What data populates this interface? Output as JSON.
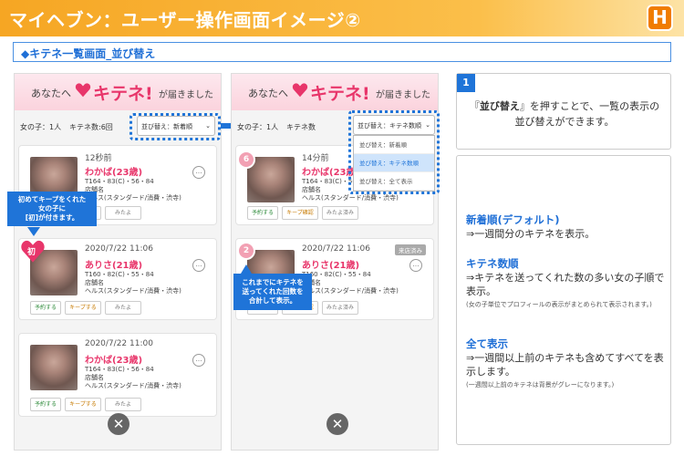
{
  "title": "マイヘブン：ユーザー操作画面イメージ②",
  "logo": "H",
  "section": "◆キテネ一覧画面_並び替え",
  "banner": {
    "prefix": "あなたへ",
    "kitene": "キテネ!",
    "suffix": "が届きました"
  },
  "left": {
    "count_girls": "女の子：1人",
    "count_kitene": "キテネ数:6回",
    "sort_label": "並び替え：新着順",
    "cards": [
      {
        "time": "12秒前",
        "name": "わかば(23歳)",
        "spec": "T164・83(C)・56・84",
        "store": "店舗名",
        "genre": "ヘルス(スタンダード/消費・渋寺)",
        "badge": ""
      },
      {
        "time": "2020/7/22 11:06",
        "name": "ありさ(21歳)",
        "spec": "T160・82(C)・55・84",
        "store": "店舗名",
        "genre": "ヘルス(スタンダード/消費・渋寺)",
        "badge": "初"
      },
      {
        "time": "2020/7/22 11:00",
        "name": "わかば(23歳)",
        "spec": "T164・83(C)・56・84",
        "store": "店舗名",
        "genre": "ヘルス(スタンダード/消費・渋寺)",
        "badge": ""
      }
    ],
    "callout": [
      "初めてキープをくれた",
      "女の子に",
      "[初]が付きます。"
    ]
  },
  "right": {
    "count_girls": "女の子：1人",
    "count_kitene": "キテネ数",
    "sort_label": "並び替え：キテネ数順",
    "dropdown": [
      "並び替え：新着順",
      "並び替え：キテネ数順",
      "並び替え：全て表示"
    ],
    "cards": [
      {
        "time": "14分前",
        "name": "わかば(23歳)",
        "spec": "T164・83(C)・56・84",
        "store": "店舗名",
        "genre": "ヘルス(スタンダード/消費・渋寺)",
        "badge": "6"
      },
      {
        "time": "2020/7/22 11:06",
        "name": "ありさ(21歳)",
        "spec": "T160・82(C)・55・84",
        "store": "店舗名",
        "genre": "ヘルス(スタンダード/消費・渋寺)",
        "badge": "2",
        "tag": "来店済み"
      }
    ],
    "callout": [
      "これまでにキテネを",
      "送ってくれた回数を",
      "合計して表示。"
    ]
  },
  "buttons": {
    "reserve": "予約する",
    "keep": "キープする",
    "keep_done": "キープ確認",
    "seen": "みたよ済み",
    "seen_btn": "みたよ",
    "more": "…",
    "close": "✕"
  },
  "panel1": {
    "num": "1",
    "line1_pre": "『",
    "line1_bold": "並び替え",
    "line1_post": "』を押すことで、一覧の表示の",
    "line2": "並び替えができます。"
  },
  "panel2": [
    {
      "head": "新着順(デフォルト)",
      "desc": "⇒一週間分のキテネを表示。",
      "sub": ""
    },
    {
      "head": "キテネ数順",
      "desc": "⇒キテネを送ってくれた数の多い女の子順で表示。",
      "sub": "(女の子単位でプロフィールの表示がまとめられて表示されます。)"
    },
    {
      "head": "全て表示",
      "desc": "⇒一週間以上前のキテネも含めてすべてを表示します。",
      "sub": "(一週間以上前のキテネは背景がグレーになります。)"
    }
  ],
  "colors": {
    "accent": "#1f74d8",
    "header": "#f6a623",
    "pink": "#e8356a"
  }
}
